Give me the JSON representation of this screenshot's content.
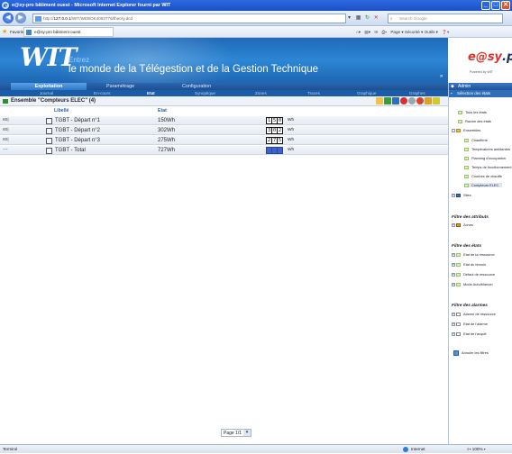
{
  "window": {
    "title": "e@sy-pro bâtiment ouest - Microsoft Internet Explorer fourni par WIT"
  },
  "address": {
    "url_host": "127.0.0.1",
    "url_prefix": "http://",
    "url_path": "/WIT/WEBOK4083776/theory.dcd",
    "search_placeholder": "Search Google"
  },
  "favorites": {
    "label": "Favoris",
    "tab": "e@sy-pro bâtiment ouest",
    "tools": "Page ▾  Sécurité ▾  Outils ▾"
  },
  "banner": {
    "brand": "WIT",
    "entrez": "Entrez",
    "tagline": "le monde de la Télégestion et de la Gestion Technique"
  },
  "rbanner": {
    "logo_a": "e@sy",
    "logo_b": ".pro",
    "powered": "Powered by WIT"
  },
  "nav": {
    "primary": [
      "Exploitation",
      "Paramétrage",
      "Configuration"
    ],
    "secondary": [
      "Journal",
      "En-cours",
      "Etat",
      "Synoptique",
      "Zones",
      "Traces",
      "Graphique",
      "Graphes"
    ]
  },
  "content": {
    "title": "Ensemble \"Compteurs ELEC\" (4)",
    "col_label": "Libellé",
    "col_state": "Etat",
    "rows": [
      {
        "id": "60|",
        "label": "TGBT - Départ n°1",
        "value": "150Wh",
        "digits": [
          "1",
          "5",
          "0"
        ],
        "unit": "Wh"
      },
      {
        "id": "60|",
        "label": "TGBT - Départ n°2",
        "value": "302Wh",
        "digits": [
          "3",
          "0",
          "2"
        ],
        "unit": "Wh"
      },
      {
        "id": "60|",
        "label": "TGBT - Départ n°3",
        "value": "275Wh",
        "digits": [
          "2",
          "7",
          "5"
        ],
        "unit": "Wh"
      },
      {
        "id": "~~",
        "label": "TGBT - Total",
        "value": "727Wh",
        "digits": [
          "",
          "",
          ""
        ],
        "unit": "Wh"
      }
    ],
    "pager": "Page 1/1"
  },
  "sidebar": {
    "admin": "Admin",
    "selection": "Sélection des états",
    "items": [
      "Tous les états",
      "Racine des états",
      "Ensembles",
      "Chaufferie",
      "Températures ambiantes",
      "Planning d'occupation",
      "Temps de fonctionnement",
      "Courbes de chauffe",
      "Compteurs ELEC",
      "Sites"
    ],
    "attr_header": "Filtre des attributs",
    "attr_items": [
      "Zones"
    ],
    "state_header": "Filtre des états",
    "state_items": [
      "Etat de la ressource",
      "Etat du témoin",
      "Défaut de ressource",
      "Mode Auto/Manuel"
    ],
    "alarm_header": "Filtre des alarmes",
    "alarm_items": [
      "Alarme de ressource",
      "Etat de l'alarme",
      "Etat de l'acquit"
    ],
    "cancel": "Annuler les filtres"
  },
  "status": {
    "left": "Terminé",
    "zone": "Internet",
    "zoom": "100%"
  }
}
